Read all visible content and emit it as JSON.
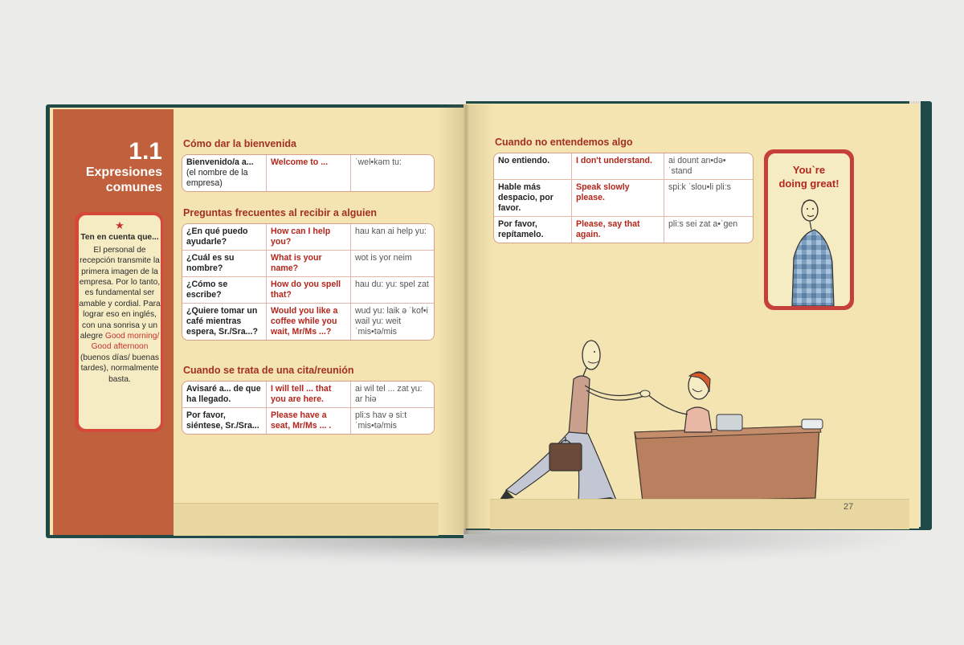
{
  "left_page": {
    "chapter_number": "1.1",
    "chapter_title_line1": "Expresiones",
    "chapter_title_line2": "comunes",
    "tip": {
      "star": "★",
      "heading": "Ten en cuenta que...",
      "body_intro": "El personal de recepción transmite la primera imagen de la empresa. Por lo tanto, es fundamental ser amable y cordial. Para lograr eso en inglés, con una sonrisa y un alegre",
      "highlight": "Good morning/ Good afternoon",
      "body_outro": "(buenos días/ buenas tardes), normalmente basta."
    },
    "sections": [
      {
        "title": "Cómo dar la bienvenida",
        "rows": [
          {
            "es": "Bienvenido/a a...",
            "es_note": "(el nombre de la empresa)",
            "en": "Welcome to ...",
            "ph": "ˈwel•kəm tu:"
          }
        ]
      },
      {
        "title": "Preguntas frecuentes al recibir a alguien",
        "rows": [
          {
            "es": "¿En qué puedo ayudarle?",
            "en": "How can I help you?",
            "ph": "hau kan ai help yu:"
          },
          {
            "es": "¿Cuál es su nombre?",
            "en": "What is your name?",
            "ph": "wot is yor neim"
          },
          {
            "es": "¿Cómo se escribe?",
            "en": "How do you spell that?",
            "ph": "hau du: yu: spel zat"
          },
          {
            "es": "¿Quiere tomar un café mientras espera, Sr./Sra...?",
            "en": "Would you like a coffee while you wait, Mr/Ms ...?",
            "ph": "wud yu: laik ə ˈkof•i wail yu: weit ˈmis•tə/mis"
          }
        ]
      },
      {
        "title": "Cuando se trata de una cita/reunión",
        "rows": [
          {
            "es": "Avisaré a... de que ha llegado.",
            "en": "I will tell ... that you are here.",
            "ph": "ai wil tel ... zat yu: ar hiə"
          },
          {
            "es": "Por favor, siéntese, Sr./Sra...",
            "en": "Please have a seat, Mr/Ms ... .",
            "ph": "pli:s hav ə si:t ˈmis•tə/mis"
          }
        ]
      }
    ]
  },
  "right_page": {
    "section": {
      "title": "Cuando no entendemos algo",
      "rows": [
        {
          "es": "No entiendo.",
          "en": "I don't understand.",
          "ph": "ai dount an•də•ˈstand"
        },
        {
          "es": "Hable más despacio, por favor.",
          "en": "Speak slowly please.",
          "ph": "spi:k ˈslou•li pli:s"
        },
        {
          "es": "Por favor, repítamelo.",
          "en": "Please, say that again.",
          "ph": "pli:s sei zat a•ˈgen"
        }
      ]
    },
    "badge_line1": "You`re",
    "badge_line2": "doing great!",
    "page_number": "27"
  },
  "colors": {
    "page": "#f3e4b2",
    "sidebar": "#c0603d",
    "accent_red": "#b3261c",
    "cover": "#1f4a48"
  }
}
